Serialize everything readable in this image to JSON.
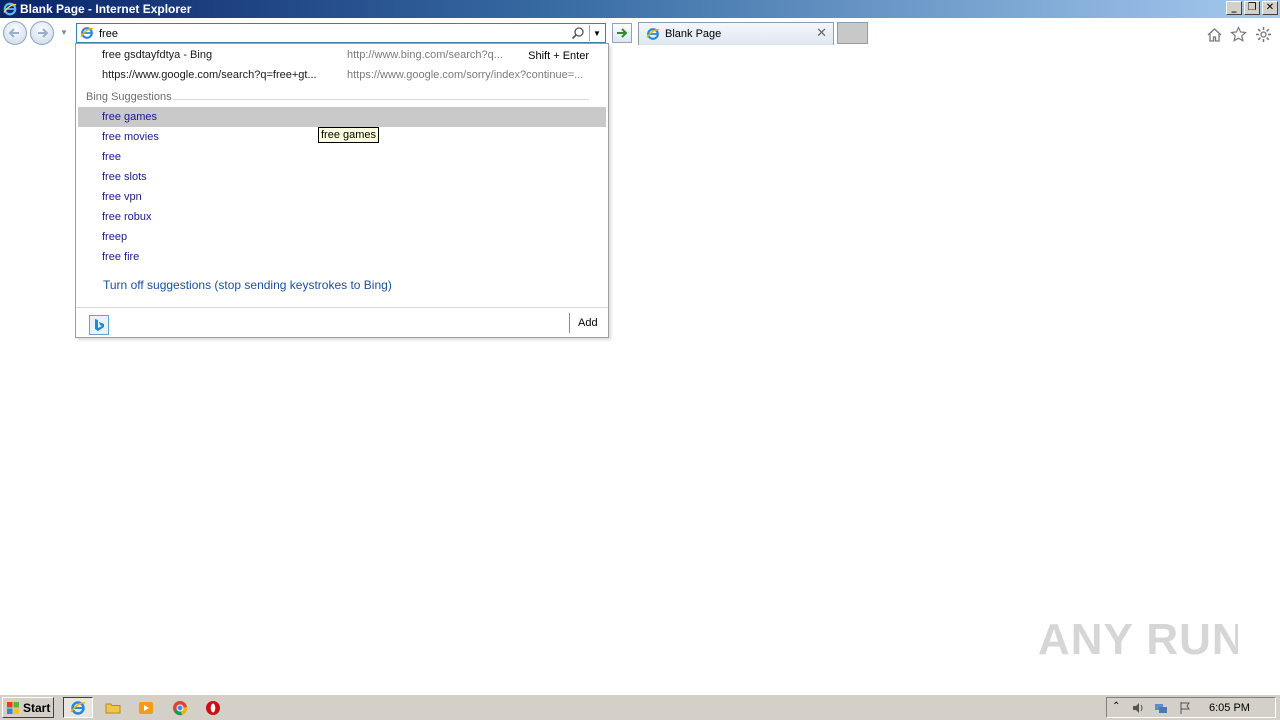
{
  "window": {
    "title": "Blank Page - Internet Explorer",
    "buttons": [
      "_",
      "❐",
      "✕"
    ]
  },
  "toolbar": {
    "address_value": "free",
    "tab_label": "Blank Page",
    "tab_close": "✕"
  },
  "dropdown": {
    "history": [
      {
        "title": "free gsdtayfdtya - Bing",
        "url": "http://www.bing.com/search?q...",
        "shortcut": "Shift + Enter"
      },
      {
        "title": "https://www.google.com/search?q=free+gt...",
        "url": "https://www.google.com/sorry/index?continue=...",
        "shortcut": ""
      }
    ],
    "group_header": "Bing Suggestions",
    "suggestions": [
      "free games",
      "free movies",
      "free",
      "free slots",
      "free vpn",
      "free robux",
      "freep",
      "free fire"
    ],
    "selected_index": 0,
    "turn_off_label": "Turn off suggestions (stop sending keystrokes to Bing)",
    "add_label": "Add"
  },
  "tooltip": "free games",
  "watermark": "ANY RUN",
  "taskbar": {
    "start_label": "Start",
    "clock": "6:05 PM"
  },
  "colors": {
    "titlebar_start": "#0a246a",
    "titlebar_end": "#a6caf0",
    "suggestion_text": "#1a1a8a",
    "selected_row": "#c9c9c9",
    "link": "#1a4f9c"
  }
}
